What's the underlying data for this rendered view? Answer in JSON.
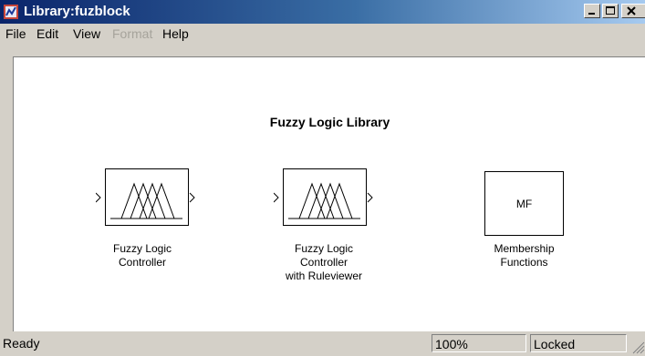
{
  "window": {
    "title": "Library:fuzblock",
    "controls": {
      "minimize": "minimize-icon",
      "maximize": "maximize-icon",
      "close": "close-icon"
    }
  },
  "menu": [
    {
      "label": "File",
      "enabled": true
    },
    {
      "label": "Edit",
      "enabled": true
    },
    {
      "label": "View",
      "enabled": true
    },
    {
      "label": "Format",
      "enabled": false
    },
    {
      "label": "Help",
      "enabled": true
    }
  ],
  "canvas": {
    "title": "Fuzzy Logic Library",
    "blocks": [
      {
        "line1": "Fuzzy Logic",
        "line2": "Controller",
        "line3": ""
      },
      {
        "line1": "Fuzzy Logic",
        "line2": "Controller",
        "line3": "with Ruleviewer"
      },
      {
        "line1": "Membership",
        "line2": "Functions",
        "line3": "",
        "icon_text": "MF"
      }
    ]
  },
  "status": {
    "text": "Ready",
    "zoom": "100%",
    "lock": "Locked"
  },
  "colors": {
    "title_gradient_start": "#0a246a",
    "title_gradient_end": "#a6caf0",
    "chrome": "#d4d0c8"
  }
}
